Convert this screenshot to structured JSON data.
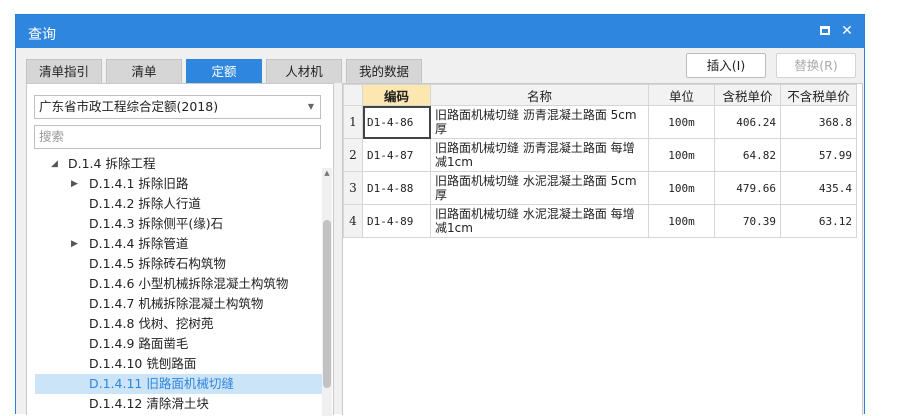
{
  "window": {
    "title": "查询",
    "maximize_icon": "maximize-icon",
    "close_icon": "close-icon",
    "close_glyph": "✕"
  },
  "tabs": [
    {
      "label": "清单指引",
      "active": false
    },
    {
      "label": "清单",
      "active": false
    },
    {
      "label": "定额",
      "active": true
    },
    {
      "label": "人材机",
      "active": false
    },
    {
      "label": "我的数据",
      "active": false
    }
  ],
  "toolbar": {
    "insert_label": "插入(I)",
    "replace_label": "替换(R)"
  },
  "library_select": {
    "value": "广东省市政工程综合定额(2018)",
    "caret_icon": "chevron-down-icon"
  },
  "search": {
    "value": "",
    "placeholder": "搜索"
  },
  "tree": {
    "items": [
      {
        "label": "D.1.4 拆除工程",
        "level": 0,
        "expanded": true
      },
      {
        "label": "D.1.4.1 拆除旧路",
        "level": 1,
        "collapsed": true
      },
      {
        "label": "D.1.4.2 拆除人行道",
        "level": 1
      },
      {
        "label": "D.1.4.3 拆除侧平(缘)石",
        "level": 1
      },
      {
        "label": "D.1.4.4 拆除管道",
        "level": 1,
        "collapsed": true
      },
      {
        "label": "D.1.4.5 拆除砖石构筑物",
        "level": 1
      },
      {
        "label": "D.1.4.6 小型机械拆除混凝土构筑物",
        "level": 1
      },
      {
        "label": "D.1.4.7 机械拆除混凝土构筑物",
        "level": 1
      },
      {
        "label": "D.1.4.8 伐树、挖树蔸",
        "level": 1
      },
      {
        "label": "D.1.4.9 路面凿毛",
        "level": 1
      },
      {
        "label": "D.1.4.10 铣刨路面",
        "level": 1
      },
      {
        "label": "D.1.4.11 旧路面机械切缝",
        "level": 1,
        "selected": true
      },
      {
        "label": "D.1.4.12 清除滑土块",
        "level": 1
      }
    ]
  },
  "table": {
    "headers": [
      "编码",
      "名称",
      "单位",
      "含税单价",
      "不含税单价"
    ],
    "rows": [
      {
        "no": "1",
        "code": "D1-4-86",
        "name": "旧路面机械切缝 沥青混凝土路面 5cm厚",
        "unit": "100m",
        "price_tax": "406.24",
        "price_notax": "368.8"
      },
      {
        "no": "2",
        "code": "D1-4-87",
        "name": "旧路面机械切缝 沥青混凝土路面 每增减1cm",
        "unit": "100m",
        "price_tax": "64.82",
        "price_notax": "57.99"
      },
      {
        "no": "3",
        "code": "D1-4-88",
        "name": "旧路面机械切缝 水泥混凝土路面 5cm厚",
        "unit": "100m",
        "price_tax": "479.66",
        "price_notax": "435.4"
      },
      {
        "no": "4",
        "code": "D1-4-89",
        "name": "旧路面机械切缝 水泥混凝土路面 每增减1cm",
        "unit": "100m",
        "price_tax": "70.39",
        "price_notax": "63.12"
      }
    ]
  },
  "colors": {
    "accent": "#2f86de",
    "selected_row_bg": "#cce4f7",
    "header_highlight": "#fde7b0"
  }
}
